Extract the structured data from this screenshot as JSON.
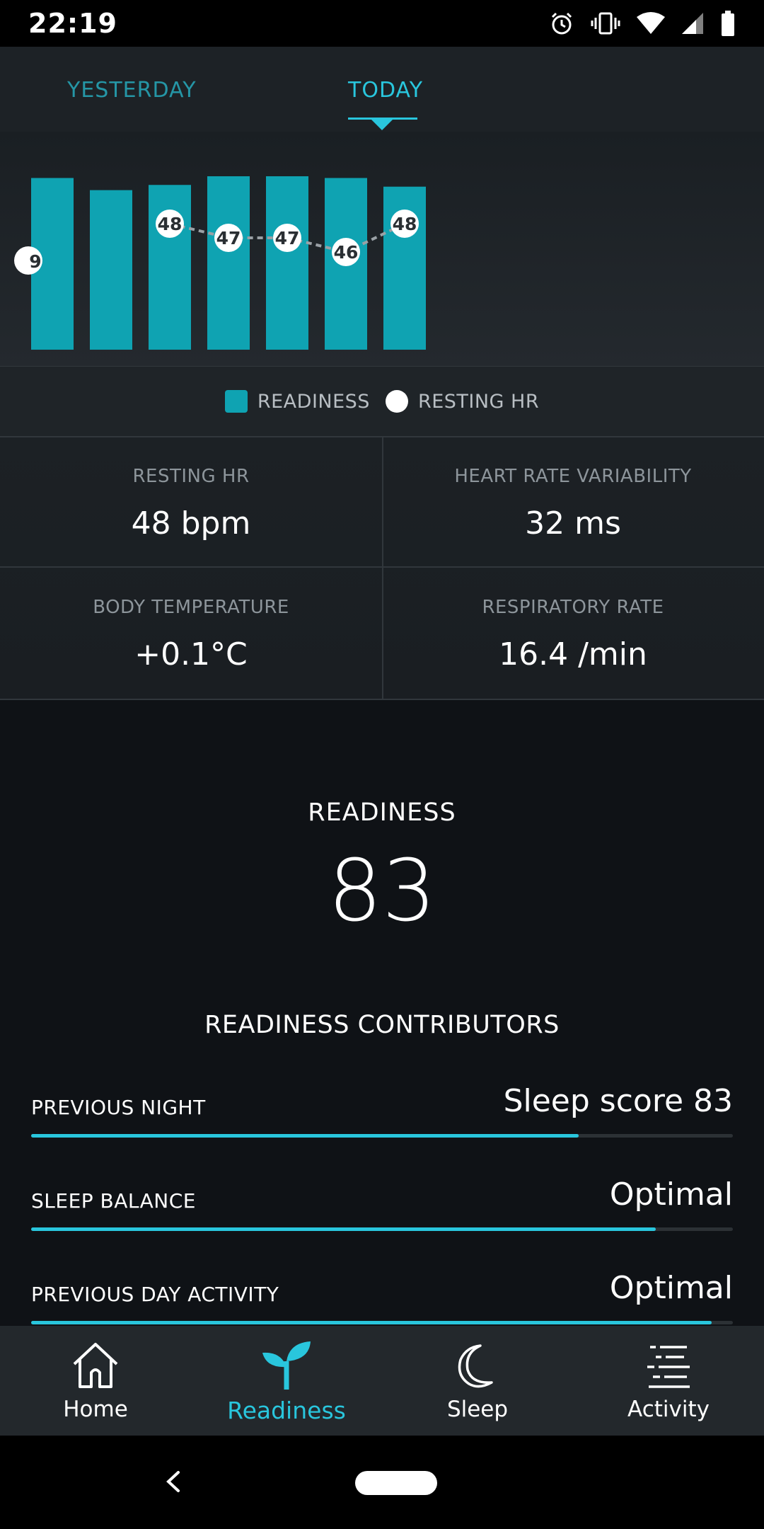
{
  "status_bar": {
    "time": "22:19"
  },
  "tabs": {
    "yesterday": "YESTERDAY",
    "today": "TODAY"
  },
  "chart_data": {
    "type": "bar",
    "bars": [
      {
        "readiness_height_rel": 0.99,
        "hr_label": "9"
      },
      {
        "readiness_height_rel": 0.92,
        "hr_label": null
      },
      {
        "readiness_height_rel": 0.95,
        "hr_label": "48"
      },
      {
        "readiness_height_rel": 1.0,
        "hr_label": "47"
      },
      {
        "readiness_height_rel": 1.0,
        "hr_label": "47"
      },
      {
        "readiness_height_rel": 0.99,
        "hr_label": "46"
      },
      {
        "readiness_height_rel": 0.94,
        "hr_label": "48"
      }
    ],
    "resting_hr": [
      null,
      null,
      48,
      47,
      47,
      46,
      48
    ],
    "legend": {
      "readiness": "READINESS",
      "resting_hr": "RESTING HR"
    },
    "colors": {
      "bar": "#0fa3b2",
      "dot": "#ffffff",
      "line": "#9aa1a6"
    }
  },
  "metrics": {
    "resting_hr": {
      "label": "RESTING HR",
      "value": "48 bpm"
    },
    "hrv": {
      "label": "HEART RATE VARIABILITY",
      "value": "32 ms"
    },
    "body_temp": {
      "label": "BODY TEMPERATURE",
      "value": "+0.1°C"
    },
    "resp_rate": {
      "label": "RESPIRATORY RATE",
      "value": "16.4 /min"
    }
  },
  "readiness": {
    "title": "READINESS",
    "score": "83"
  },
  "contributors": {
    "title": "READINESS CONTRIBUTORS",
    "items": [
      {
        "label": "PREVIOUS NIGHT",
        "value": "Sleep score 83",
        "level": 0.78
      },
      {
        "label": "SLEEP BALANCE",
        "value": "Optimal",
        "level": 0.89
      },
      {
        "label": "PREVIOUS DAY ACTIVITY",
        "value": "Optimal",
        "level": 0.97
      }
    ]
  },
  "nav": {
    "home": "Home",
    "readiness": "Readiness",
    "sleep": "Sleep",
    "activity": "Activity"
  },
  "colors": {
    "accent": "#29c6dd",
    "bar": "#0fa3b2"
  }
}
